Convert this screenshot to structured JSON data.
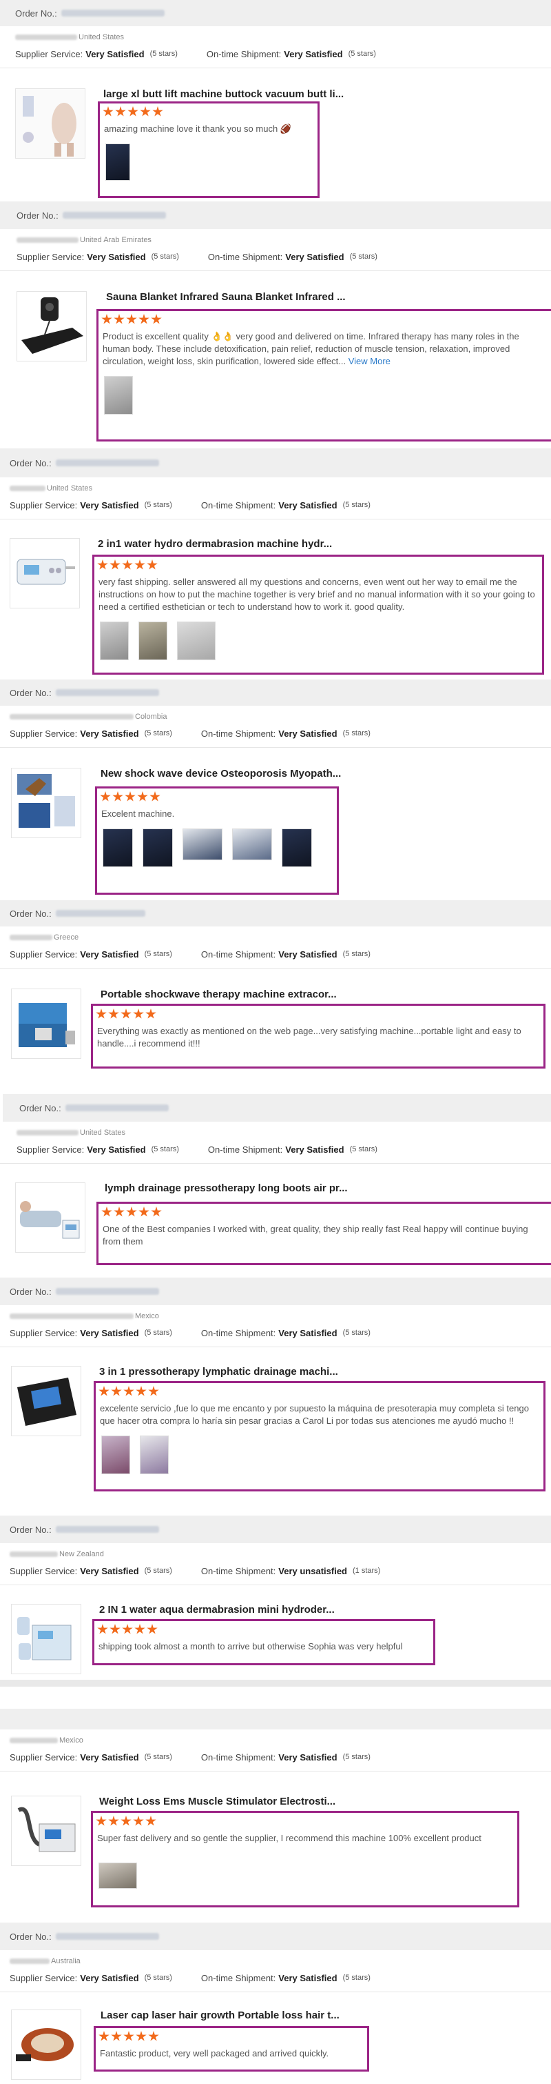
{
  "labels": {
    "order_no": "Order No.:",
    "supplier_service": "Supplier Service:",
    "ontime_shipment": "On-time Shipment:",
    "view_more": "View More"
  },
  "reviews": [
    {
      "country": "United States",
      "supplier_rating": "Very Satisfied",
      "supplier_stars": "(5 stars)",
      "shipment_rating": "Very Satisfied",
      "shipment_stars": "(5 stars)",
      "product_title": "large xl butt lift machine buttock vacuum butt li...",
      "stars": 5,
      "text": "amazing machine love it thank you so much 🏈"
    },
    {
      "country": "United Arab Emirates",
      "supplier_rating": "Very Satisfied",
      "supplier_stars": "(5 stars)",
      "shipment_rating": "Very Satisfied",
      "shipment_stars": "(5 stars)",
      "product_title": "Sauna Blanket Infrared Sauna Blanket Infrared ...",
      "stars": 5,
      "text": "Product is excellent quality 👌👌 very good and delivered on time. Infrared therapy has many roles in the human body. These include detoxification, pain relief, reduction of muscle tension, relaxation, improved circulation, weight loss, skin purification, lowered side effect..."
    },
    {
      "country": "United States",
      "supplier_rating": "Very Satisfied",
      "supplier_stars": "(5 stars)",
      "shipment_rating": "Very Satisfied",
      "shipment_stars": "(5 stars)",
      "product_title": "2 in1 water hydro dermabrasion machine hydr...",
      "stars": 5,
      "text": "very fast shipping. seller answered all my questions and concerns, even went out her way to email me the instructions on how to put the machine together is very brief and no manual information with it so your going to need a certified esthetician or tech to understand how to work it. good quality."
    },
    {
      "country": "Colombia",
      "supplier_rating": "Very Satisfied",
      "supplier_stars": "(5 stars)",
      "shipment_rating": "Very Satisfied",
      "shipment_stars": "(5 stars)",
      "product_title": "New shock wave device Osteoporosis Myopath...",
      "stars": 5,
      "text": "Excelent machine."
    },
    {
      "country": "Greece",
      "supplier_rating": "Very Satisfied",
      "supplier_stars": "(5 stars)",
      "shipment_rating": "Very Satisfied",
      "shipment_stars": "(5 stars)",
      "product_title": "Portable shockwave therapy machine extracor...",
      "stars": 5,
      "text": "Everything was exactly as mentioned on the web page...very satisfying machine...portable light and easy to handle....i recommend it!!!"
    },
    {
      "country": "United States",
      "supplier_rating": "Very Satisfied",
      "supplier_stars": "(5 stars)",
      "shipment_rating": "Very Satisfied",
      "shipment_stars": "(5 stars)",
      "product_title": "lymph drainage pressotherapy long boots air pr...",
      "stars": 5,
      "text": "One of the Best companies I worked with, great quality, they ship really fast Real happy will continue buying from them"
    },
    {
      "country": "Mexico",
      "supplier_rating": "Very Satisfied",
      "supplier_stars": "(5 stars)",
      "shipment_rating": "Very Satisfied",
      "shipment_stars": "(5 stars)",
      "product_title": "3 in 1 pressotherapy lymphatic drainage machi...",
      "stars": 5,
      "text": "excelente servicio ,fue lo que me encanto y por supuesto la máquina de presoterapia muy completa si tengo que hacer otra compra lo haría sin pesar gracias a Carol Li por todas sus atenciones me ayudó mucho !!"
    },
    {
      "country": "New Zealand",
      "supplier_rating": "Very Satisfied",
      "supplier_stars": "(5 stars)",
      "shipment_rating": "Very unsatisfied",
      "shipment_stars": "(1 stars)",
      "product_title": "2 IN 1 water aqua dermabrasion mini hydroder...",
      "stars": 5,
      "text": "shipping took almost a month to arrive but otherwise Sophia was very helpful"
    },
    {
      "country": "Mexico",
      "supplier_rating": "Very Satisfied",
      "supplier_stars": "(5 stars)",
      "shipment_rating": "Very Satisfied",
      "shipment_stars": "(5 stars)",
      "product_title": "Weight Loss Ems Muscle Stimulator Electrosti...",
      "stars": 5,
      "text": "Super fast delivery and so gentle the supplier, I recommend this machine 100% excellent product"
    },
    {
      "country": "Australia",
      "supplier_rating": "Very Satisfied",
      "supplier_stars": "(5 stars)",
      "shipment_rating": "Very Satisfied",
      "shipment_stars": "(5 stars)",
      "product_title": "Laser cap laser hair growth Portable loss hair t...",
      "stars": 5,
      "text": "Fantastic product, very well packaged and arrived quickly."
    }
  ]
}
